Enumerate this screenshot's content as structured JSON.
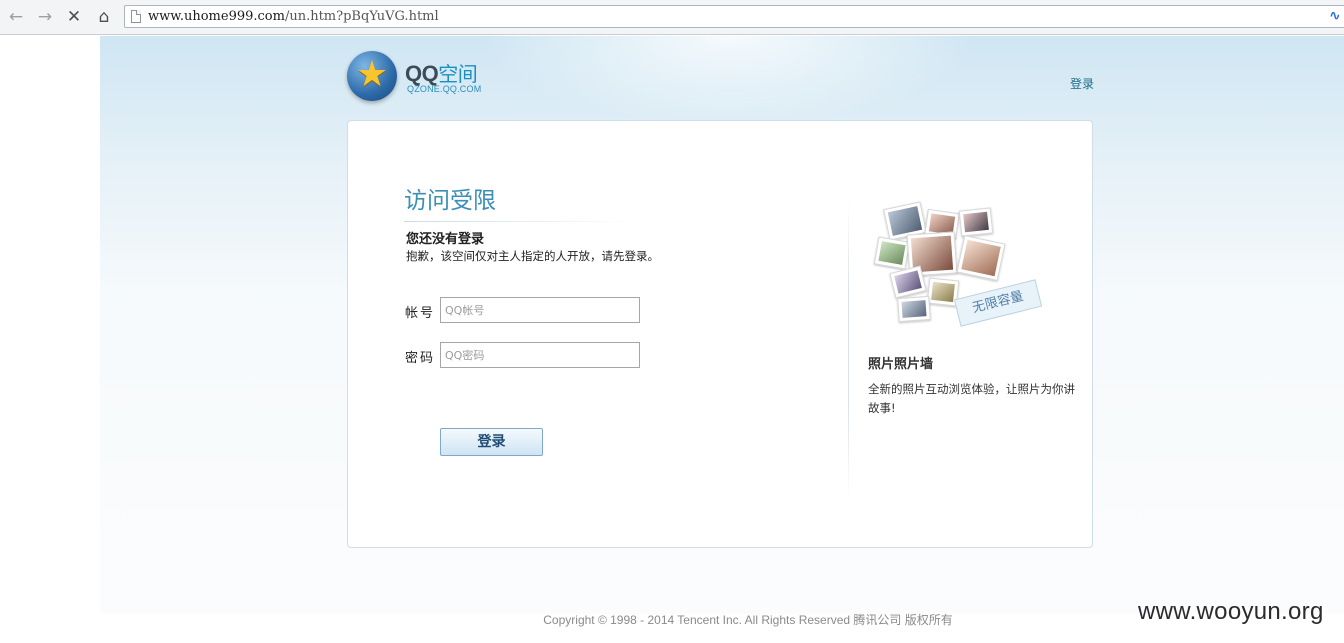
{
  "browser": {
    "url_host": "www.uhome999.com",
    "url_path": "/un.htm?pBqYuVG.html",
    "icons": [
      "back-arrow-icon",
      "forward-arrow-icon",
      "stop-icon",
      "home-icon",
      "page-icon"
    ]
  },
  "header": {
    "logo_main": "QQ",
    "logo_cn": "空间",
    "logo_sub": "QZONE.QQ.COM",
    "login_link": "登录"
  },
  "main": {
    "title": "访问受限",
    "notice_head": "您还没有登录",
    "notice_text": "抱歉，该空间仅对主人指定的人开放，请先登录。",
    "account_label": "帐号",
    "account_placeholder": "QQ帐号",
    "password_label": "密码",
    "password_placeholder": "QQ密码",
    "login_button": "登录"
  },
  "feature": {
    "stamp_text": "无限容量",
    "title": "照片照片墙",
    "description": "全新的照片互动浏览体验，让照片为你讲故事!"
  },
  "footer": {
    "copyright": "Copyright © 1998 - 2014 Tencent Inc. All Rights Reserved 腾讯公司  版权所有"
  },
  "watermark": "www.wooyun.org",
  "colors": {
    "accent": "#3a8fb6",
    "link": "#1e6b86",
    "card_border": "#cfdde6"
  }
}
